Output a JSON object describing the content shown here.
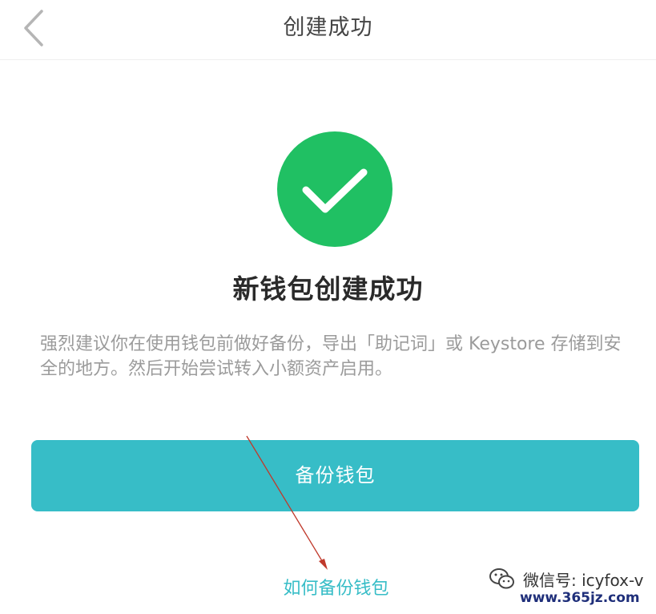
{
  "header": {
    "title": "创建成功",
    "back_icon": "chevron-left-icon"
  },
  "success": {
    "icon": "checkmark-circle-icon",
    "icon_color": "#20c063",
    "title": "新钱包创建成功",
    "advice": "强烈建议你在使用钱包前做好备份，导出「助记词」或 Keystore 存储到安全的地方。然后开始尝试转入小额资产启用。"
  },
  "actions": {
    "backup_label": "备份钱包",
    "backup_color": "#37bdc7",
    "how_to_backup_label": "如何备份钱包"
  },
  "watermark": {
    "icon": "wechat-icon",
    "text": "微信号: icyfox-v",
    "url": "www.365jz.com"
  },
  "annotation": {
    "arrow_color": "#c0392b"
  }
}
